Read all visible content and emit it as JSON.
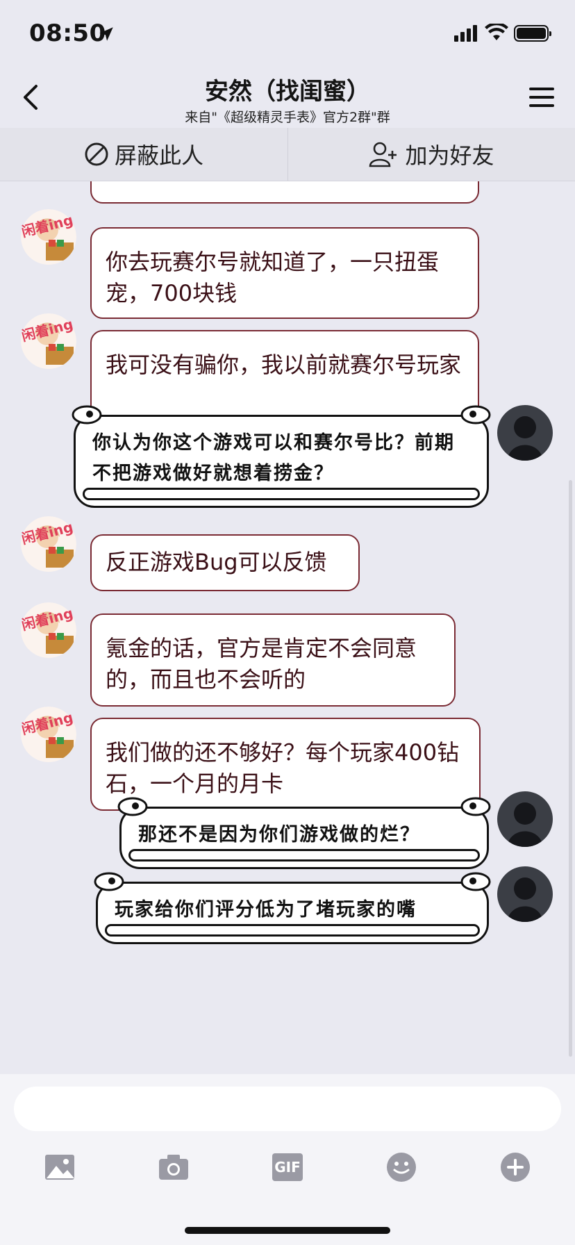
{
  "status": {
    "time": "08:50"
  },
  "header": {
    "title": "安然（找闺蜜）",
    "subtitle": "来自\"《超级精灵手表》官方2群\"群"
  },
  "actions": {
    "block_label": "屏蔽此人",
    "add_friend_label": "加为好友"
  },
  "sticker_tag": "闲着ing",
  "messages": [
    {
      "side": "left",
      "text": "你去玩赛尔号就知道了，一只扭蛋宠，700块钱"
    },
    {
      "side": "left",
      "text": "我可没有骗你，我以前就赛尔号玩家"
    },
    {
      "side": "right",
      "text": "你认为你这个游戏可以和赛尔号比？前期不把游戏做好就想着捞金？"
    },
    {
      "side": "left",
      "text": "反正游戏Bug可以反馈"
    },
    {
      "side": "left",
      "text": "氪金的话，官方是肯定不会同意的，而且也不会听的"
    },
    {
      "side": "left",
      "text": "我们做的还不够好？每个玩家400钻石，一个月的月卡"
    },
    {
      "side": "right",
      "text": "那还不是因为你们游戏做的烂？"
    },
    {
      "side": "right",
      "text": "玩家给你们评分低为了堵玩家的嘴"
    }
  ],
  "composer": {
    "tools": [
      "image-icon",
      "camera-icon",
      "gif-icon",
      "emoji-icon",
      "plus-icon"
    ],
    "gif_label": "GIF"
  },
  "colors": {
    "background": "#e9e9f1",
    "bubble_border_left": "#7a2a33",
    "bubble_text_left": "#3a0f16",
    "bubble_border_right": "#111111",
    "deco_orange": "#f5a623"
  }
}
